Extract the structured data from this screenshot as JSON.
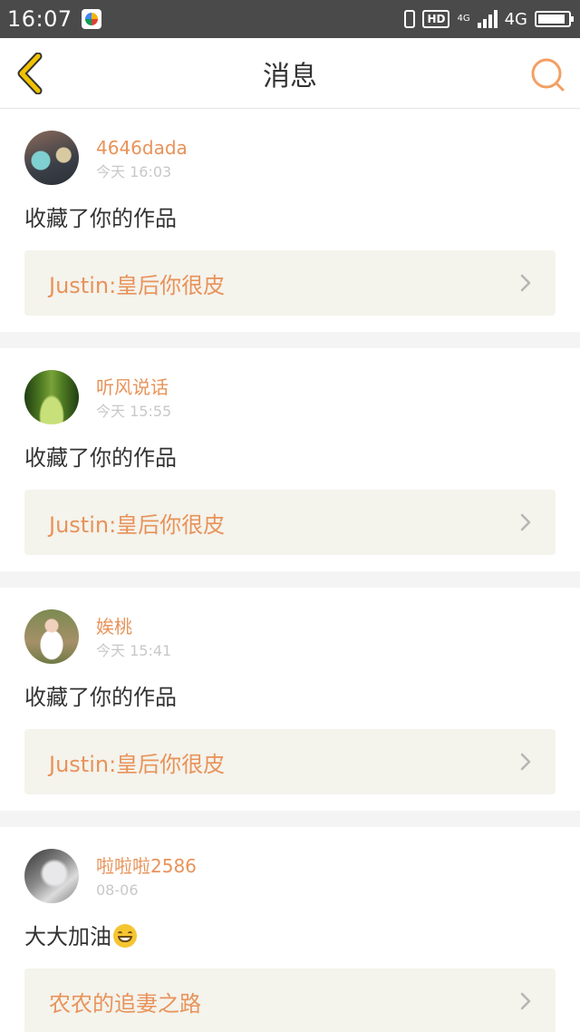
{
  "status_bar": {
    "time": "16:07",
    "hd": "HD",
    "network_small": "4G",
    "network": "4G"
  },
  "nav": {
    "title": "消息",
    "back_icon": "chevron-left-icon",
    "search_icon": "search-icon"
  },
  "colors": {
    "accent": "#e8935a",
    "back_icon": "#f2c200",
    "status_bar_bg": "#4a4a4a",
    "ref_bg": "#f4f3ec"
  },
  "messages": [
    {
      "username": "4646dada",
      "time": "今天 16:03",
      "action": "收藏了你的作品",
      "ref": "Justin:皇后你很皮"
    },
    {
      "username": "听风说话",
      "time": "今天 15:55",
      "action": "收藏了你的作品",
      "ref": "Justin:皇后你很皮"
    },
    {
      "username": "娭桃",
      "time": "今天 15:41",
      "action": "收藏了你的作品",
      "ref": "Justin:皇后你很皮"
    },
    {
      "username": "啦啦啦2586",
      "time": "08-06",
      "action": "大大加油",
      "ref": "农农的追妻之路"
    }
  ]
}
